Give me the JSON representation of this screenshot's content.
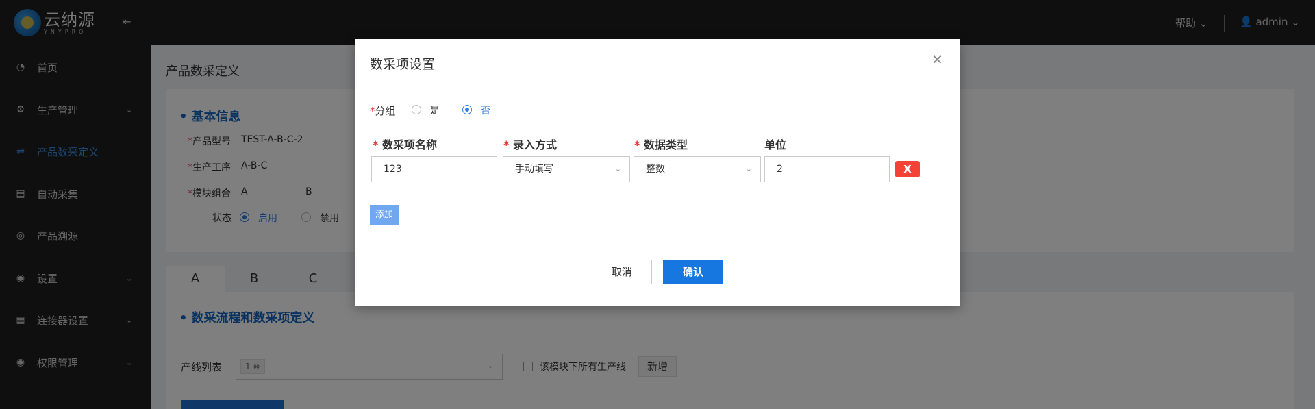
{
  "header": {
    "logo_cn": "云纳源",
    "logo_en": "YNYPRO",
    "help_label": "帮助",
    "user_name": "admin",
    "collapse_icon": "menu-fold-icon"
  },
  "sidebar": {
    "items": [
      {
        "label": "首页",
        "icon": "dashboard-icon",
        "has_chevron": false
      },
      {
        "label": "生产管理",
        "icon": "gear-icon",
        "has_chevron": true
      },
      {
        "label": "产品数采定义",
        "icon": "link-icon",
        "has_chevron": false,
        "active": true
      },
      {
        "label": "自动采集",
        "icon": "book-icon",
        "has_chevron": false
      },
      {
        "label": "产品溯源",
        "icon": "trace-icon",
        "has_chevron": false
      },
      {
        "label": "设置",
        "icon": "settings-icon",
        "has_chevron": true
      },
      {
        "label": "连接器设置",
        "icon": "table-icon",
        "has_chevron": true
      },
      {
        "label": "权限管理",
        "icon": "lock-icon",
        "has_chevron": true
      }
    ],
    "active_color": "#3a8ee6"
  },
  "main": {
    "page_title": "产品数采定义",
    "basic_info_title": "基本信息",
    "product_model_label": "产品型号",
    "product_model_value": "TEST-A-B-C-2",
    "process_label": "生产工序",
    "process_value": "A-B-C",
    "module_combo_label": "模块组合",
    "module_combo_a": "A",
    "module_combo_b": "B",
    "status_label": "状态",
    "status_enabled": "启用",
    "status_disabled": "禁用",
    "tabs": [
      "A",
      "B",
      "C"
    ],
    "flow_title": "数采流程和数采项定义",
    "line_list_label": "产线列表",
    "line_tag": "1",
    "all_lines_checkbox_label": "该模块下所有生产线",
    "new_button": "新增"
  },
  "modal": {
    "title": "数采项设置",
    "group_label": "分组",
    "group_yes": "是",
    "group_no": "否",
    "group_selected": "否",
    "columns": [
      "数采项名称",
      "录入方式",
      "数据类型",
      "单位"
    ],
    "row": {
      "name": "123",
      "input_method": "手动填写",
      "data_type": "整数",
      "unit": "2"
    },
    "delete_button": "X",
    "add_button": "添加",
    "cancel_button": "取消",
    "confirm_button": "确认",
    "accent": "#1677e0",
    "danger": "#f44336"
  }
}
